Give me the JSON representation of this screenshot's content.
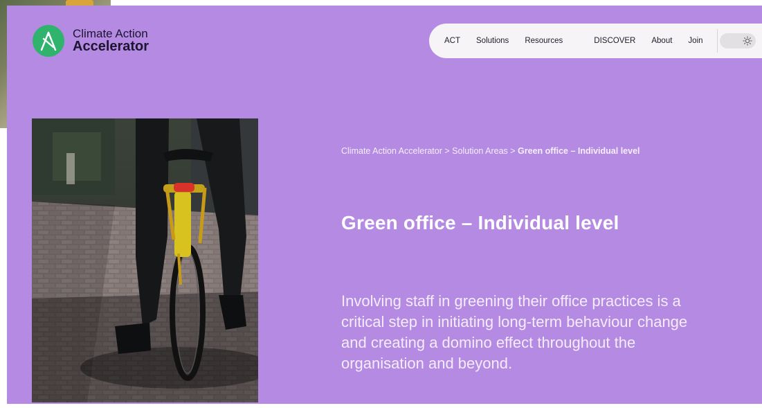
{
  "brand": {
    "name_line1": "Climate Action",
    "name_line2": "Accelerator",
    "logo_color": "#2fb36d"
  },
  "nav": {
    "items": [
      {
        "label": "ACT"
      },
      {
        "label": "Solutions"
      },
      {
        "label": "Resources"
      },
      {
        "label": "DISCOVER"
      },
      {
        "label": "About"
      },
      {
        "label": "Join"
      }
    ],
    "theme_toggle_icon": "sun-icon"
  },
  "breadcrumb": {
    "items": [
      "Climate Action Accelerator",
      "Solution Areas"
    ],
    "separator": ">",
    "current": "Green office – Individual level"
  },
  "page": {
    "title": "Green office – Individual level",
    "lead": "Involving staff in greening their office practices is a critical step in initiating long-term behaviour change and creating a domino effect throughout the organisation and beyond."
  },
  "colors": {
    "panel_background": "#b58ae2",
    "nav_background": "#f6f4f6",
    "text_light": "#ffffff"
  }
}
